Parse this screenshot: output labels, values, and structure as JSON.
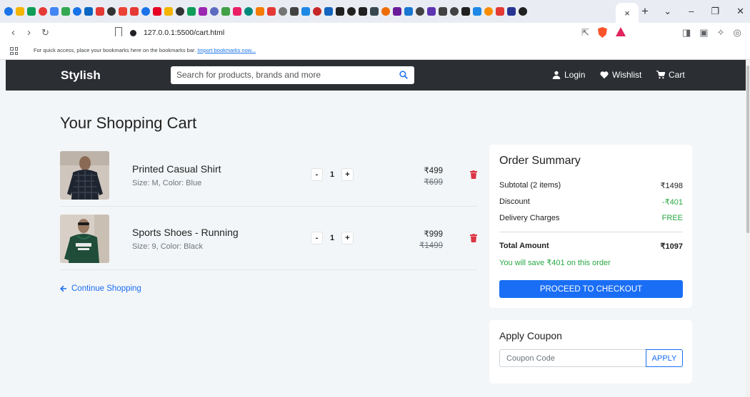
{
  "browser": {
    "active_tab_close": "×",
    "new_tab": "+",
    "url": "127.0.0.1:5500/cart.html",
    "bookmarks_bar_text": "For quick access, place your bookmarks here on the bookmarks bar.",
    "bookmarks_bar_link": "Import bookmarks now...",
    "favicon_colors": [
      "#1a73e8",
      "#f4b400",
      "#0f9d58",
      "#e53935",
      "#4285f4",
      "#34a853",
      "#1a73e8",
      "#0a66c2",
      "#e53935",
      "#333333",
      "#ea4335",
      "#e53935",
      "#1a73e8",
      "#e60023",
      "#f4b400",
      "#333333",
      "#0f9d58",
      "#9c27b0",
      "#5c6bc0",
      "#43a047",
      "#e91e63",
      "#00897b",
      "#f57c00",
      "#e53935",
      "#757575",
      "#424242",
      "#1e88e5",
      "#c62828",
      "#1565c0",
      "#212121",
      "#212121",
      "#212121",
      "#37474f",
      "#ef6c00",
      "#6a1b9a",
      "#1976d2",
      "#424242",
      "#5e35b1",
      "#424242",
      "#424242",
      "#212121",
      "#1e88e5",
      "#fb8c00",
      "#e53935",
      "#283593",
      "#212121"
    ]
  },
  "navbar": {
    "brand": "Stylish",
    "search_placeholder": "Search for products, brands and more",
    "login": "Login",
    "wishlist": "Wishlist",
    "cart": "Cart"
  },
  "page": {
    "title": "Your Shopping Cart",
    "continue": "Continue Shopping"
  },
  "cart": {
    "items": [
      {
        "name": "Printed Casual Shirt",
        "meta": "Size: M, Color: Blue",
        "qty": "1",
        "minus": "-",
        "plus": "+",
        "price": "₹499",
        "original_price": "₹699"
      },
      {
        "name": "Sports Shoes - Running",
        "meta": "Size: 9, Color: Black",
        "qty": "1",
        "minus": "-",
        "plus": "+",
        "price": "₹999",
        "original_price": "₹1499"
      }
    ]
  },
  "summary": {
    "title": "Order Summary",
    "subtotal_label": "Subtotal (2 items)",
    "subtotal_value": "₹1498",
    "discount_label": "Discount",
    "discount_value": "-₹401",
    "delivery_label": "Delivery Charges",
    "delivery_value": "FREE",
    "total_label": "Total Amount",
    "total_value": "₹1097",
    "save_note": "You will save ₹401 on this order",
    "checkout": "PROCEED TO CHECKOUT"
  },
  "coupon": {
    "title": "Apply Coupon",
    "placeholder": "Coupon Code",
    "apply": "APPLY"
  },
  "colors": {
    "accent": "#1a6ef5",
    "navbar": "#2b2e32",
    "success": "#28a745",
    "danger": "#dc3545"
  }
}
